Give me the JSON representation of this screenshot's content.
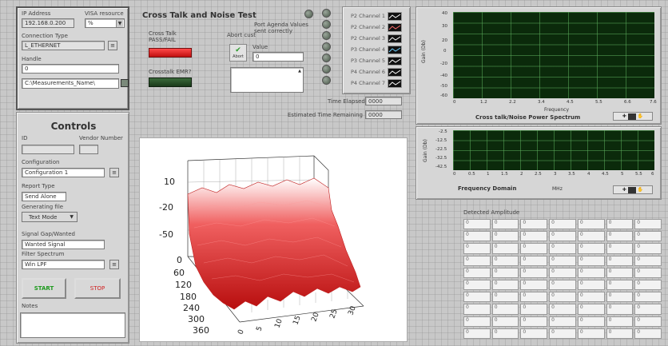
{
  "connection": {
    "ip_label": "IP Address",
    "ip_value": "192.168.0.200",
    "visa_label": "VISA resource",
    "visa_value": "%",
    "conn_type_label": "Connection Type",
    "conn_type_value": "L_ETHERNET",
    "handle_label": "Handle",
    "handle_value": "0",
    "path_value": "C:\\Measurements_Name\\"
  },
  "test": {
    "title": "Cross Talk and Noise Test",
    "cross_talk_label": "Cross Talk PASS/FAIL",
    "unknown_label": "Crosstalk EMR?",
    "abort_label": "Abort cust",
    "abort_button": "Abort",
    "port_label": "Port Agenda Values sent correctly",
    "value_label": "Value",
    "value_field": "0"
  },
  "channels": [
    {
      "label": "P2 Channel 1",
      "color": "#ffffff"
    },
    {
      "label": "P2 Channel 2",
      "color": "#ff6a6a"
    },
    {
      "label": "P2 Channel 3",
      "color": "#ffffff"
    },
    {
      "label": "P3 Channel 4",
      "color": "#6fd0ff"
    },
    {
      "label": "P3 Channel 5",
      "color": "#ffffff"
    },
    {
      "label": "P4 Channel 6",
      "color": "#ffffff"
    },
    {
      "label": "P4 Channel 7",
      "color": "#ffffff"
    }
  ],
  "timing": {
    "elapsed_label": "Time Elapsed",
    "elapsed_value": "0000",
    "remaining_label": "Estimated Time Remaining",
    "remaining_value": "0000"
  },
  "controls": {
    "heading": "Controls",
    "id_label": "ID",
    "vendor_label": "Vendor Number",
    "config_label": "Configuration",
    "config_value": "Configuration 1",
    "report_label": "Report Type",
    "report_value": "Send Alone",
    "generating_label": "Generating file",
    "generating_value": "Text Mode",
    "signal_label": "Signal Gap/Wanted",
    "signal_value": "Wanted Signal",
    "filter_label": "Filter Spectrum",
    "filter_value": "Win LPF",
    "start_button": "START",
    "stop_button": "STOP",
    "notes_label": "Notes"
  },
  "spectrum_plot": {
    "title": "Cross talk/Noise Power Spectrum",
    "ylabel": "Gain (Db)",
    "xlabel_top": "Frequency",
    "y_ticks": [
      "40",
      "30",
      "20",
      "0",
      "-20",
      "-40",
      "-50",
      "-60"
    ],
    "x_ticks": [
      "0",
      "1.2",
      "2.2",
      "3.4",
      "4.5",
      "5.5",
      "6.6",
      "7.6"
    ]
  },
  "freq_plot": {
    "ylabel": "Gain (Db)",
    "xlabel": "Frequency Domain",
    "xunit": "MHz",
    "y_ticks": [
      "-2.5",
      "-12.5",
      "-22.5",
      "-32.5",
      "-42.5"
    ],
    "x_ticks": [
      "0",
      "0.5",
      "1",
      "1.5",
      "2",
      "2.5",
      "3",
      "3.5",
      "4",
      "4.5",
      "5",
      "5.5",
      "6"
    ]
  },
  "surface": {
    "z_ticks": [
      "10",
      "-20",
      "-50"
    ],
    "y_ticks": [
      "0",
      "60",
      "120",
      "180",
      "240",
      "300",
      "360"
    ],
    "x_ticks": [
      "0",
      "5",
      "10",
      "15",
      "20",
      "25",
      "30"
    ]
  },
  "amplitude": {
    "label": "Detected Amplitude",
    "rows": 10,
    "cols": 7,
    "cell": "0"
  },
  "colors": {
    "accent_green": "#1f6f1f",
    "pass_red": "#e02020",
    "surface_red": "#d41818"
  }
}
